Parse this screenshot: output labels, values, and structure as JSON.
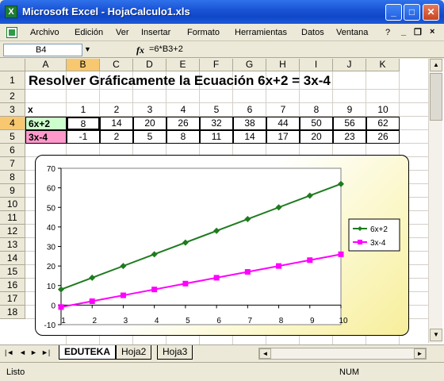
{
  "window": {
    "title": "Microsoft Excel - HojaCalculo1.xls",
    "app_icon_letter": "X",
    "min": "_",
    "max": "□",
    "close": "✕"
  },
  "menu": {
    "items": [
      "Archivo",
      "Edición",
      "Ver",
      "Insertar",
      "Formato",
      "Herramientas",
      "Datos",
      "Ventana",
      "?"
    ],
    "ctrl_min": "_",
    "ctrl_restore": "❐",
    "ctrl_close": "×"
  },
  "formula_bar": {
    "name_box": "B4",
    "fx": "fx",
    "formula": "=6*B3+2"
  },
  "grid": {
    "columns": [
      "A",
      "B",
      "C",
      "D",
      "E",
      "F",
      "G",
      "H",
      "I",
      "J",
      "K"
    ],
    "rows": [
      "1",
      "2",
      "3",
      "4",
      "5",
      "6",
      "7",
      "8",
      "9",
      "10",
      "11",
      "12",
      "13",
      "14",
      "15",
      "16",
      "17",
      "18"
    ],
    "title": "Resolver Gráficamente la Ecuación    6x+2 = 3x-4",
    "row3_label": "x",
    "row3_values": [
      "1",
      "2",
      "3",
      "4",
      "5",
      "6",
      "7",
      "8",
      "9",
      "10"
    ],
    "row4_label": "6x+2",
    "row4_values": [
      "8",
      "14",
      "20",
      "26",
      "32",
      "38",
      "44",
      "50",
      "56",
      "62"
    ],
    "row5_label": "3x-4",
    "row5_values": [
      "-1",
      "2",
      "5",
      "8",
      "11",
      "14",
      "17",
      "20",
      "23",
      "26"
    ],
    "colors": {
      "row4_label_bg": "#ccffcc",
      "row5_label_bg": "#ff99cc",
      "selection_header": "#f7c870"
    }
  },
  "chart_data": {
    "type": "line",
    "x": [
      1,
      2,
      3,
      4,
      5,
      6,
      7,
      8,
      9,
      10
    ],
    "series": [
      {
        "name": "6x+2",
        "values": [
          8,
          14,
          20,
          26,
          32,
          38,
          44,
          50,
          56,
          62
        ],
        "color": "#1e7b1e",
        "marker": "diamond"
      },
      {
        "name": "3x-4",
        "values": [
          -1,
          2,
          5,
          8,
          11,
          14,
          17,
          20,
          23,
          26
        ],
        "color": "#ff00ff",
        "marker": "square"
      }
    ],
    "ylim": [
      -10,
      70
    ],
    "yticks": [
      -10,
      0,
      10,
      20,
      30,
      40,
      50,
      60,
      70
    ],
    "xticks": [
      1,
      2,
      3,
      4,
      5,
      6,
      7,
      8,
      9,
      10
    ],
    "xlim": [
      1,
      10
    ],
    "grid": false,
    "legend": "right"
  },
  "sheet_tabs": {
    "nav": [
      "|◄",
      "◄",
      "►",
      "►|"
    ],
    "tabs": [
      "EDUTEKA",
      "Hoja2",
      "Hoja3"
    ]
  },
  "status": {
    "left": "Listo",
    "num": "NUM"
  }
}
